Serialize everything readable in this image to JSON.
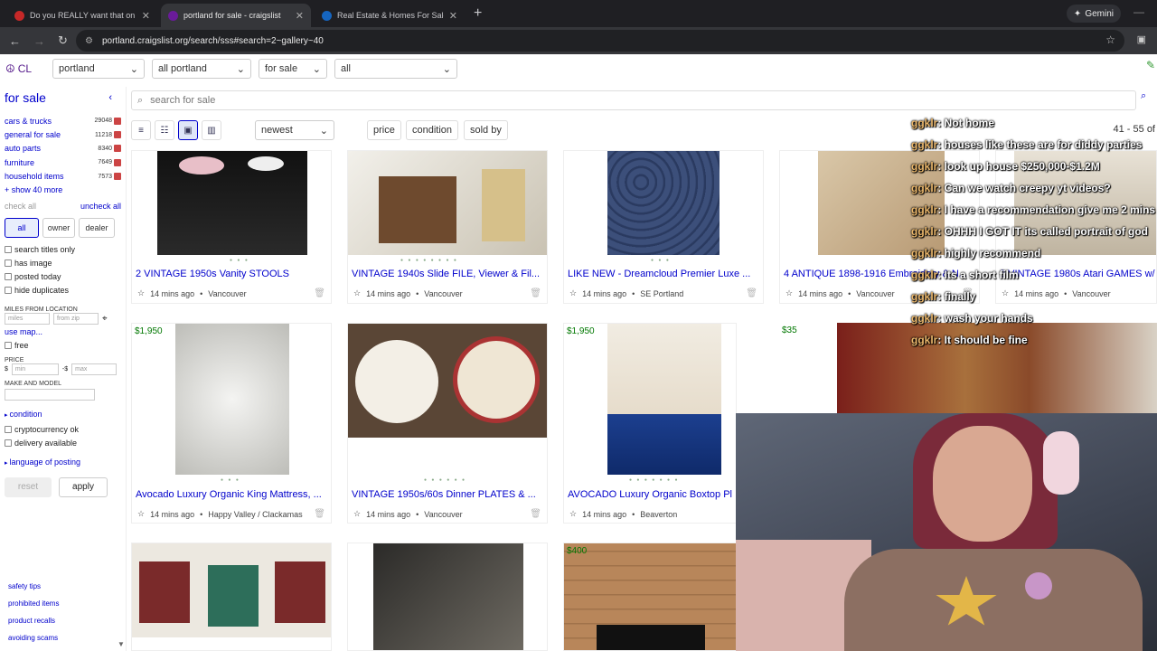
{
  "browser": {
    "tabs": [
      {
        "title": "Do you REALLY want that on yo",
        "color": "#c62828"
      },
      {
        "title": "portland for sale - craigslist",
        "color": "#6a1b9a"
      },
      {
        "title": "Real Estate & Homes For Sale -",
        "color": "#1565c0"
      }
    ],
    "gemini": "Gemini",
    "url": "portland.craigslist.org/search/sss#search=2~gallery~40"
  },
  "cl": {
    "logo": "CL",
    "location": "portland",
    "area": "all portland",
    "category": "for sale",
    "subcategory": "all",
    "search_placeholder": "search for sale",
    "sort": "newest",
    "filters": [
      "price",
      "condition",
      "sold by"
    ],
    "pagination": "41 - 55 of"
  },
  "sidebar": {
    "title": "for sale",
    "categories": [
      {
        "label": "cars & trucks",
        "count": "29048"
      },
      {
        "label": "general for sale",
        "count": "11218"
      },
      {
        "label": "auto parts",
        "count": "8340"
      },
      {
        "label": "furniture",
        "count": "7649"
      },
      {
        "label": "household items",
        "count": "7573"
      }
    ],
    "show_more": "+ show 40 more",
    "check_all": "check all",
    "uncheck_all": "uncheck all",
    "seller_buttons": [
      "all",
      "owner",
      "dealer"
    ],
    "options": [
      "search titles only",
      "has image",
      "posted today",
      "hide duplicates"
    ],
    "miles_label": "MILES FROM LOCATION",
    "miles_placeholder": "miles",
    "zip_placeholder": "from zip",
    "use_map": "use map...",
    "free": "free",
    "price_label": "PRICE",
    "min": "min",
    "max": "max",
    "make_label": "MAKE AND MODEL",
    "condition": "condition",
    "options2": [
      "cryptocurrency ok",
      "delivery available"
    ],
    "language": "language of posting",
    "reset": "reset",
    "apply": "apply",
    "footer": [
      "safety tips",
      "prohibited items",
      "product recalls",
      "avoiding scams"
    ]
  },
  "listings": [
    {
      "title": "2 VINTAGE 1950s Vanity STOOLS",
      "price": "",
      "time": "14 mins ago",
      "loc": "Vancouver"
    },
    {
      "title": "VINTAGE 1940s Slide FILE, Viewer & Fil...",
      "price": "",
      "time": "14 mins ago",
      "loc": "Vancouver"
    },
    {
      "title": "LIKE NEW - Dreamcloud Premier Luxe ...",
      "price": "",
      "time": "14 mins ago",
      "loc": "SE Portland"
    },
    {
      "title": "4 ANTIQUE 1898-1916 Embroidery & N...",
      "price": "",
      "time": "14 mins ago",
      "loc": "Vancouver"
    },
    {
      "title": "8 VINTAGE 1980s Atari GAMES w/",
      "price": "",
      "time": "14 mins ago",
      "loc": "Vancouver"
    },
    {
      "title": "Avocado Luxury Organic King Mattress, ...",
      "price": "$1,950",
      "time": "14 mins ago",
      "loc": "Happy Valley / Clackamas"
    },
    {
      "title": "VINTAGE 1950s/60s Dinner PLATES & ...",
      "price": "",
      "time": "14 mins ago",
      "loc": "Vancouver"
    },
    {
      "title": "AVOCADO Luxury Organic Boxtop Pl",
      "price": "$1,950",
      "time": "14 mins ago",
      "loc": "Beaverton"
    },
    {
      "title": "",
      "price": "$35",
      "time": "",
      "loc": ""
    },
    {
      "title": "",
      "price": "",
      "time": "",
      "loc": ""
    },
    {
      "title": "",
      "price": "",
      "time": "",
      "loc": ""
    },
    {
      "title": "",
      "price": "$400",
      "time": "",
      "loc": ""
    }
  ],
  "chat": [
    {
      "user": "ggklr",
      "msg": ": Not home"
    },
    {
      "user": "ggklr",
      "msg": ": houses like these are for diddy parties"
    },
    {
      "user": "ggklr",
      "msg": ": look up house $250,000-$1.2M"
    },
    {
      "user": "ggklr",
      "msg": ": Can we watch creepy yt videos?"
    },
    {
      "user": "ggklr",
      "msg": ": I have a recommendation give me 2 mins"
    },
    {
      "user": "ggklr",
      "msg": ": OHHH I GOT IT its called portrait of god"
    },
    {
      "user": "ggklr",
      "msg": ": highly recommend"
    },
    {
      "user": "ggklr",
      "msg": ": Its a short film"
    },
    {
      "user": "ggklr",
      "msg": ": finally"
    },
    {
      "user": "ggklr",
      "msg": ": wash your hands"
    },
    {
      "user": "ggklr",
      "msg": ": It should be fine"
    }
  ]
}
